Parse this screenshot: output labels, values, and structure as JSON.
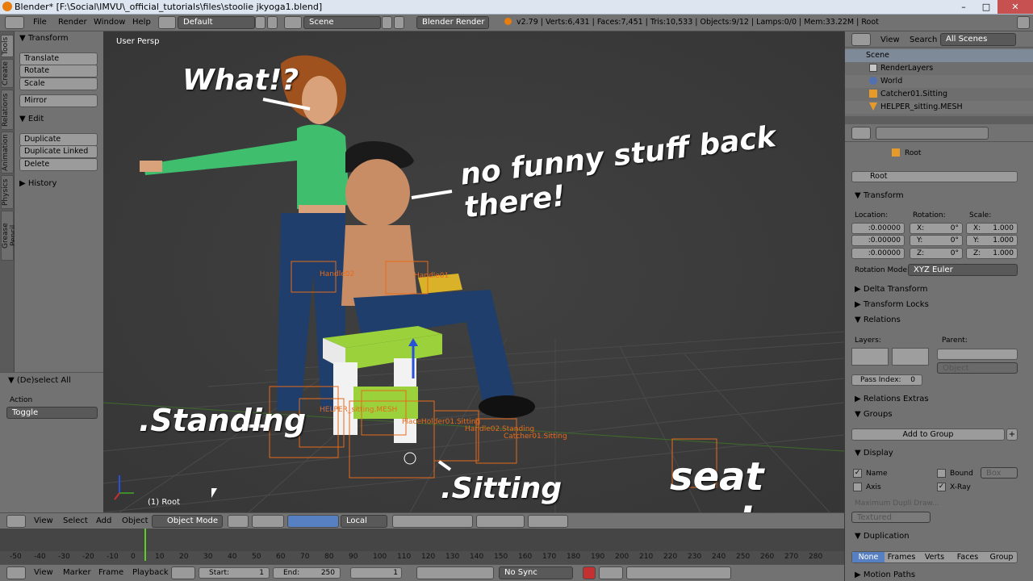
{
  "window": {
    "title": "Blender* [F:\\Social\\IMVU\\_official_tutorials\\files\\stoolie jkyoga1.blend]",
    "minimize": "–",
    "maximize": "□",
    "close": "✕"
  },
  "infobar": {
    "menus": [
      "File",
      "Render",
      "Window",
      "Help"
    ],
    "screen_layout": "Default",
    "scene": "Scene",
    "engine": "Blender Render",
    "stats": "v2.79 | Verts:6,431 | Faces:7,451 | Tris:10,533 | Objects:9/12 | Lamps:0/0 | Mem:33.22M | Root"
  },
  "left_tabs": [
    "Tools",
    "Create",
    "Relations",
    "Animation",
    "Physics",
    "Grease Pencil"
  ],
  "toolshelf": {
    "transform_header": "Transform",
    "transform_buttons": [
      "Translate",
      "Rotate",
      "Scale"
    ],
    "mirror": "Mirror",
    "edit_header": "Edit",
    "edit_buttons": [
      "Duplicate",
      "Duplicate Linked",
      "Delete"
    ],
    "history_header": "History",
    "operator_header": "(De)select All",
    "action_label": "Action",
    "action_value": "Toggle"
  },
  "viewport": {
    "view_name": "User Persp",
    "object_info": "(1) Root",
    "labels": {
      "handle02": "Handle02",
      "handle01": "Handle01",
      "helper_sitting": "HELPER_sitting.MESH",
      "placeholder_sitting": "PlaceHolder01.Sitting",
      "handle02_standing": "Handle02.Standing",
      "catcher01_sitting": "Catcher01.Sitting"
    },
    "annotations": {
      "what": "What!?",
      "no_funny": "no funny stuff back there!",
      "standing": ".Standing",
      "sitting": ".Sitting",
      "seat_nodes": "seat nodes"
    }
  },
  "viewport_header": {
    "menus": [
      "View",
      "Select",
      "Add",
      "Object"
    ],
    "mode": "Object Mode",
    "orientation": "Local"
  },
  "timeline": {
    "ticks": [
      "-50",
      "-40",
      "-30",
      "-20",
      "-10",
      "0",
      "10",
      "20",
      "30",
      "40",
      "50",
      "60",
      "70",
      "80",
      "90",
      "100",
      "110",
      "120",
      "130",
      "140",
      "150",
      "160",
      "170",
      "180",
      "190",
      "200",
      "210",
      "220",
      "230",
      "240",
      "250",
      "260",
      "270",
      "280"
    ],
    "menus": [
      "View",
      "Marker",
      "Frame",
      "Playback"
    ],
    "start_label": "Start:",
    "start_value": "1",
    "end_label": "End:",
    "end_value": "250",
    "current_frame": "1",
    "sync": "No Sync"
  },
  "outliner": {
    "menus": [
      "View",
      "Search"
    ],
    "filter": "All Scenes",
    "items": [
      "Scene",
      "RenderLayers",
      "World",
      "Catcher01.Sitting",
      "HELPER_sitting.MESH"
    ]
  },
  "properties": {
    "breadcrumb": "Root",
    "object_name": "Root",
    "transform": "Transform",
    "location_label": "Location:",
    "rotation_label": "Rotation:",
    "scale_label": "Scale:",
    "location": [
      ":0.00000",
      ":0.00000",
      ":0.00000"
    ],
    "rotation": [
      {
        "axis": "X:",
        "value": "0°"
      },
      {
        "axis": "Y:",
        "value": "0°"
      },
      {
        "axis": "Z:",
        "value": "0°"
      }
    ],
    "scale": [
      {
        "axis": "X:",
        "value": "1.000"
      },
      {
        "axis": "Y:",
        "value": "1.000"
      },
      {
        "axis": "Z:",
        "value": "1.000"
      }
    ],
    "rotation_mode_label": "Rotation Mode:",
    "rotation_mode": "XYZ Euler",
    "delta_transform": "Delta Transform",
    "transform_locks": "Transform Locks",
    "relations": "Relations",
    "layers_label": "Layers:",
    "parent_label": "Parent:",
    "parent_type": "Object",
    "pass_index_label": "Pass Index:",
    "pass_index": "0",
    "relations_extras": "Relations Extras",
    "groups": "Groups",
    "add_to_group": "Add to Group",
    "display": "Display",
    "name": "Name",
    "bound": "Bound",
    "bound_type": "Box",
    "axis": "Axis",
    "xray": "X-Ray",
    "max_dupli": "Maximum Dupli Draw...",
    "textured": "Textured",
    "duplication": "Duplication",
    "dup_options": [
      "None",
      "Frames",
      "Verts",
      "Faces",
      "Group"
    ],
    "motion_paths": "Motion Paths"
  }
}
